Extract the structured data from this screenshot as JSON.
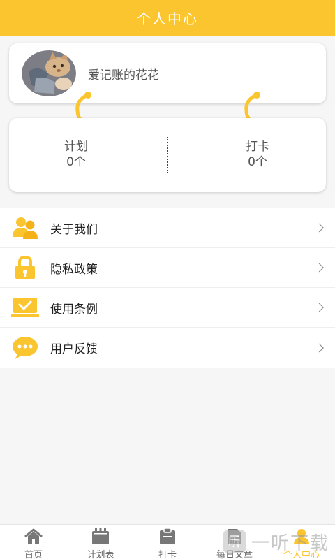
{
  "header": {
    "title": "个人中心"
  },
  "profile": {
    "username": "爱记账的花花",
    "avatar_icon": "cat-avatar-icon"
  },
  "stats": {
    "plan": {
      "label": "计划",
      "value": "0个"
    },
    "checkin": {
      "label": "打卡",
      "value": "0个"
    }
  },
  "menu": {
    "items": [
      {
        "label": "关于我们",
        "icon": "users-icon"
      },
      {
        "label": "隐私政策",
        "icon": "lock-icon"
      },
      {
        "label": "使用条例",
        "icon": "laptop-check-icon"
      },
      {
        "label": "用户反馈",
        "icon": "chat-bubble-icon"
      }
    ]
  },
  "tabbar": {
    "items": [
      {
        "label": "首页",
        "icon": "home-icon"
      },
      {
        "label": "计划表",
        "icon": "calendar-icon"
      },
      {
        "label": "打卡",
        "icon": "clipboard-icon"
      },
      {
        "label": "每日文章",
        "icon": "document-icon"
      },
      {
        "label": "个人中心",
        "icon": "person-icon",
        "active": true
      }
    ]
  },
  "watermark": {
    "text": "一听下载",
    "logo": "听"
  },
  "colors": {
    "accent": "#fbc52f",
    "background": "#f6f6f6"
  }
}
